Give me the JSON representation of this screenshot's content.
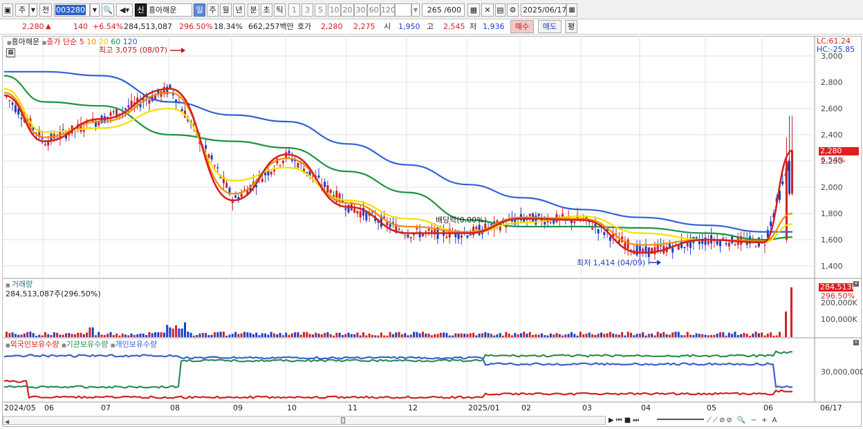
{
  "toolbar": {
    "market_label": "주",
    "prev_label": "전",
    "code": "003280",
    "new_badge": "신",
    "stock_name": "흥아해운",
    "periods": [
      "일",
      "주",
      "월",
      "년",
      "분",
      "초",
      "틱"
    ],
    "active_period": "일",
    "intervals": [
      "1",
      "3",
      "5",
      "10",
      "20",
      "30",
      "60",
      "120"
    ],
    "count_display": "265 /600",
    "date": "2025/06/17"
  },
  "quote": {
    "price": "2,280",
    "change_arrow": "▲",
    "change": "140",
    "change_pct": "+6.54%",
    "volume": "284,513,087",
    "volume_ratio": "296.50%",
    "turnover": "18.34%",
    "amount": "662,257백만",
    "ask_label": "호가",
    "ask": "2,280",
    "bid": "2,275",
    "open_label": "시",
    "open": "1,950",
    "high_label": "고",
    "high": "2,545",
    "low_label": "저",
    "low": "1,936",
    "buy_label": "매수",
    "sell_label": "매도",
    "avg_label": "평"
  },
  "price_panel": {
    "stock_name": "흥아해운",
    "ma_title": "종가 단순",
    "ma_periods": [
      "5",
      "10",
      "20",
      "60",
      "120"
    ],
    "ma_colors": [
      "#d42020",
      "#f08c00",
      "#f5e000",
      "#1a9440",
      "#3060dd"
    ],
    "high_annotation": "최고 3,075 (08/07)",
    "low_annotation": "최저 1,414 (04/09)",
    "dividend_annotation": "배당락(0.00%)",
    "lc_label": "LC:61.24",
    "hc_label": "HC:-25.85",
    "price_tag": "2,280",
    "pct_tag": "6.54%",
    "y_ticks": [
      "3,000",
      "2,800",
      "2,600",
      "2,400",
      "2,200",
      "2,000",
      "1,800",
      "1,600",
      "1,400"
    ]
  },
  "volume_panel": {
    "title": "거래량",
    "value_text": "284,513,087주(296.50%)",
    "tag_value": "284,513K",
    "tag_pct": "296.50%",
    "y_ticks": [
      "200,000K",
      "100,000K"
    ]
  },
  "holding_panel": {
    "legends": [
      "외국인보유수량",
      "기관보유수량",
      "개인보유수량"
    ],
    "colors": [
      "#d42020",
      "#2e8b57",
      "#3a5fd0"
    ],
    "y_tick": "30,000,000"
  },
  "x_axis": {
    "labels": [
      "2024/05",
      "06",
      "07",
      "08",
      "09",
      "10",
      "11",
      "12",
      "2025/01",
      "02",
      "03",
      "04",
      "05",
      "06",
      "06/17"
    ]
  },
  "chart_data": {
    "type": "line",
    "title": "",
    "xlabel": "",
    "ylabel": "",
    "ylim": [
      1350,
      3100
    ],
    "x": [
      "2024/05",
      "06",
      "07",
      "08",
      "09",
      "10",
      "11",
      "12",
      "2025/01",
      "02",
      "03",
      "04",
      "05",
      "06",
      "06/17"
    ],
    "series": [
      {
        "name": "5",
        "values": [
          2700,
          2350,
          2520,
          2750,
          1900,
          2250,
          1850,
          1650,
          1650,
          1760,
          1750,
          1500,
          1600,
          1580,
          2280
        ]
      },
      {
        "name": "10",
        "values": [
          2720,
          2380,
          2500,
          2720,
          1950,
          2220,
          1880,
          1700,
          1660,
          1770,
          1760,
          1560,
          1600,
          1590,
          1800
        ]
      },
      {
        "name": "20",
        "values": [
          2750,
          2420,
          2450,
          2600,
          2050,
          2150,
          1900,
          1760,
          1650,
          1730,
          1780,
          1650,
          1600,
          1580,
          1720
        ]
      },
      {
        "name": "60",
        "values": [
          2850,
          2650,
          2620,
          2400,
          2350,
          2300,
          2120,
          1960,
          1750,
          1700,
          1700,
          1690,
          1650,
          1600,
          1620
        ]
      },
      {
        "name": "120",
        "values": [
          2880,
          2880,
          2850,
          2650,
          2550,
          2500,
          2330,
          2170,
          2020,
          1920,
          1830,
          1770,
          1710,
          1660,
          1660
        ]
      }
    ]
  }
}
